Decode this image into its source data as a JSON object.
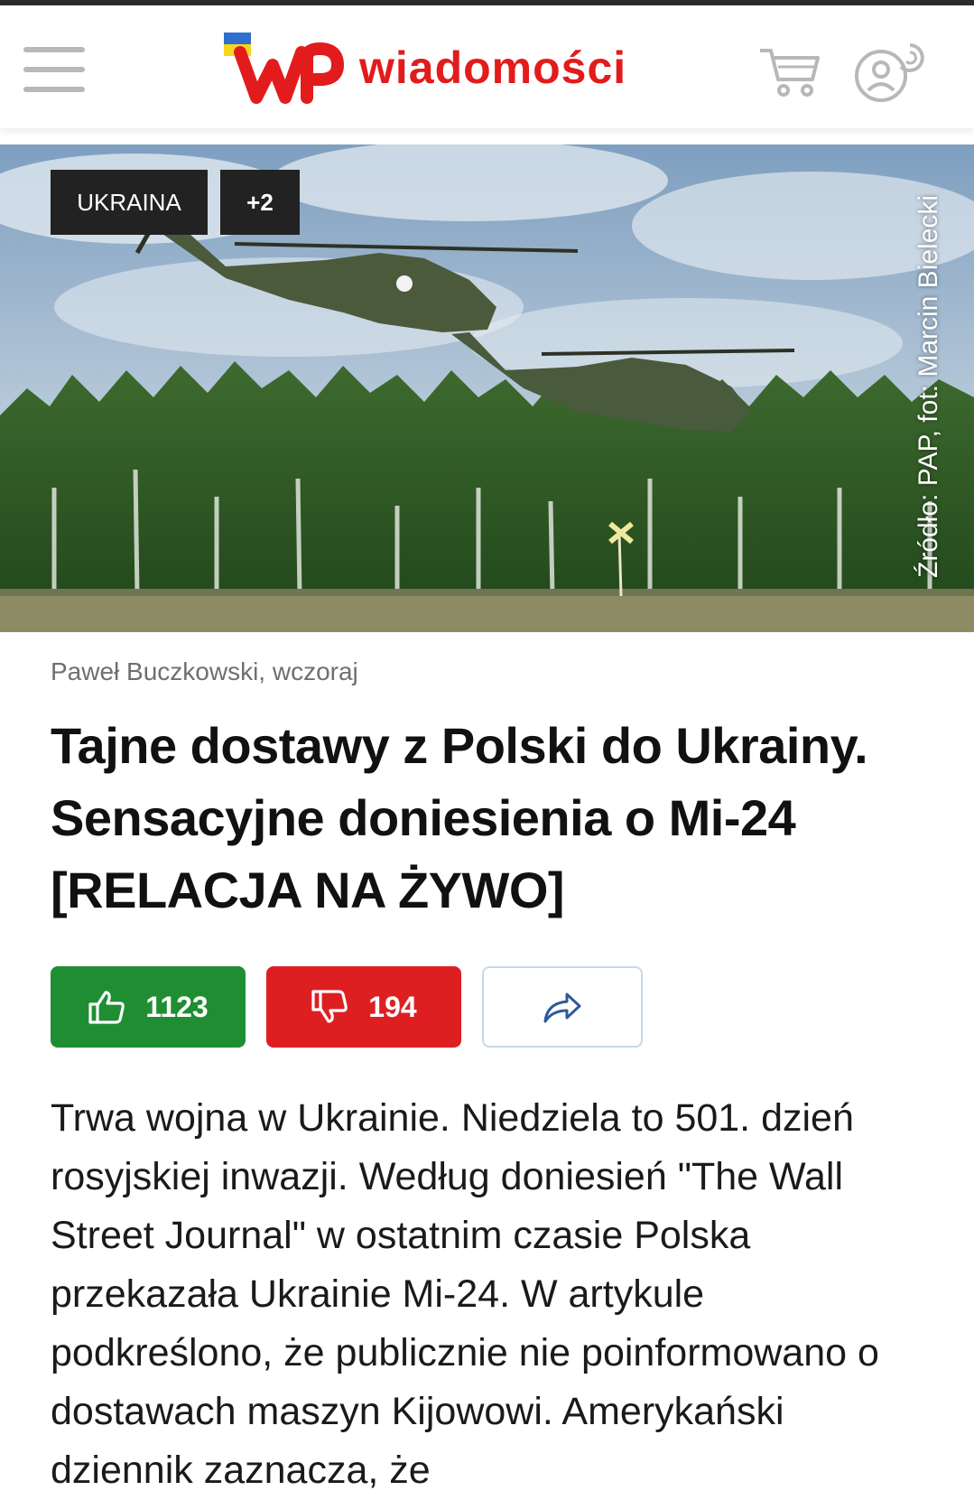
{
  "header": {
    "logo_text": "wiadomości",
    "menu_icon": "hamburger-menu-icon",
    "cart_icon": "cart-icon",
    "user_icon": "user-account-icon",
    "flag_colors": [
      "#2f6fd0",
      "#f7d51d"
    ],
    "brand_color": "#e21c1c"
  },
  "hero": {
    "tags": [
      "UKRAINA",
      "+2"
    ],
    "photo_credit": "Źródło: PAP, fot: Marcin Bielecki"
  },
  "article": {
    "byline": "Paweł Buczkowski, wczoraj",
    "title": "Tajne dostawy z Polski do Ukrainy. Sensacyjne doniesienia o Mi-24 [RELACJA NA ŻYWO]",
    "body": "Trwa wojna w Ukrainie. Niedziela to 501. dzień rosyjskiej inwazji. Według doniesień \"The Wall Street Journal\" w ostatnim czasie Polska przekazała Ukrainie Mi-24. W artykule podkreślono, że publicznie nie poinformowano o dostawach maszyn Kijowowi. Amerykański dziennik zaznacza, że"
  },
  "reactions": {
    "likes": "1123",
    "dislikes": "194",
    "like_color": "#1f8e33",
    "dislike_color": "#de1f22"
  }
}
